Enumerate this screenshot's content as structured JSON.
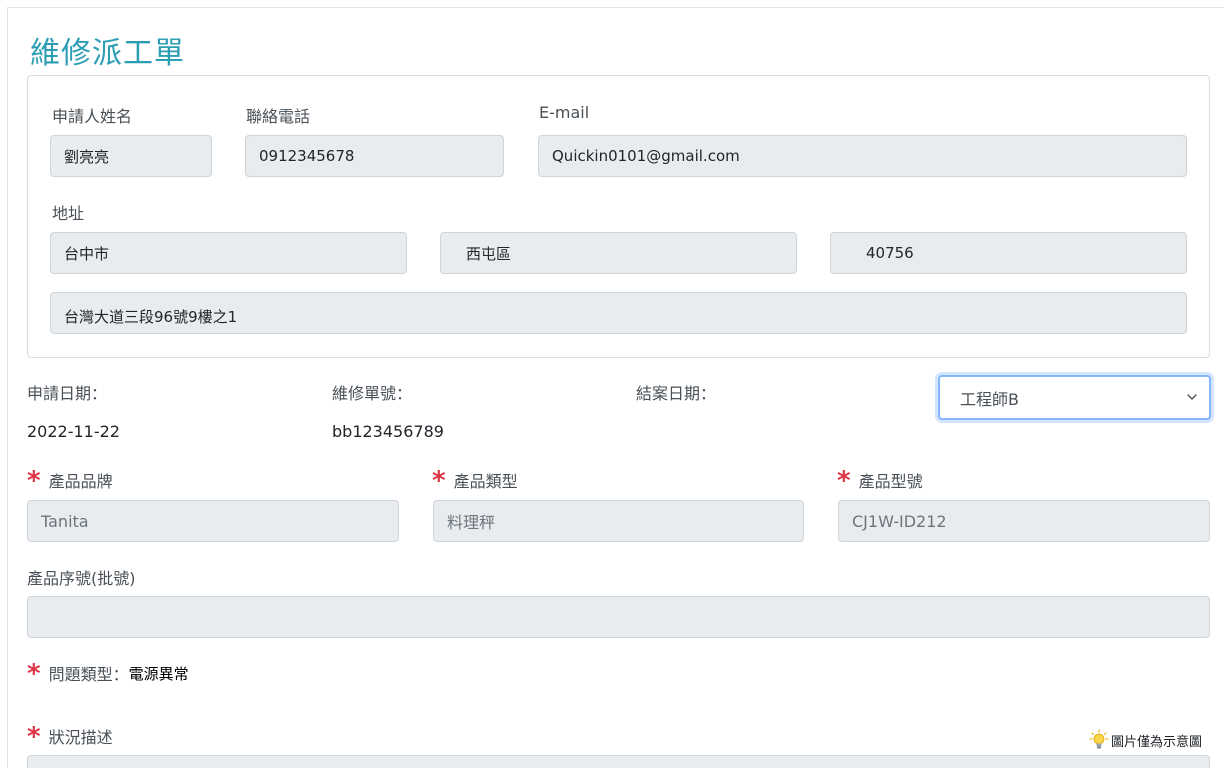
{
  "form": {
    "title": "維修派工單",
    "applicant": {
      "name_label": "申請人姓名",
      "name_value": "劉亮亮",
      "phone_label": "聯絡電話",
      "phone_value": "0912345678",
      "email_label": "E-mail",
      "email_value": "Quickin0101@gmail.com",
      "address_label": "地址",
      "city_value": "台中市",
      "district_value": "西屯區",
      "zip_value": "40756",
      "street_value": "台灣大道三段96號9樓之1"
    },
    "meta": {
      "apply_date_label": "申請日期：",
      "apply_date_value": "2022-11-22",
      "order_no_label": "維修單號：",
      "order_no_value": "bb123456789",
      "close_date_label": "結案日期：",
      "engineer_selected": "工程師B"
    },
    "product": {
      "brand_label": "產品品牌",
      "brand_value": "Tanita",
      "type_label": "產品類型",
      "type_value": "料理秤",
      "model_label": "產品型號",
      "model_value": "CJ1W-ID212",
      "serial_label": "產品序號(批號)",
      "serial_value": ""
    },
    "issue": {
      "problem_type_label": "問題類型：",
      "problem_type_value": "電源異常",
      "description_label": "狀況描述",
      "image_note": "圖片僅為示意圖"
    },
    "required_mark": "*"
  },
  "colors": {
    "title": "#2b9eb3",
    "required": "#dc3545",
    "field_bg": "#e9ecef",
    "focus_border": "#86b7fe"
  },
  "icons": {
    "chevron": "chevron-down-icon",
    "bulb": "lightbulb-icon",
    "required": "asterisk-icon"
  }
}
